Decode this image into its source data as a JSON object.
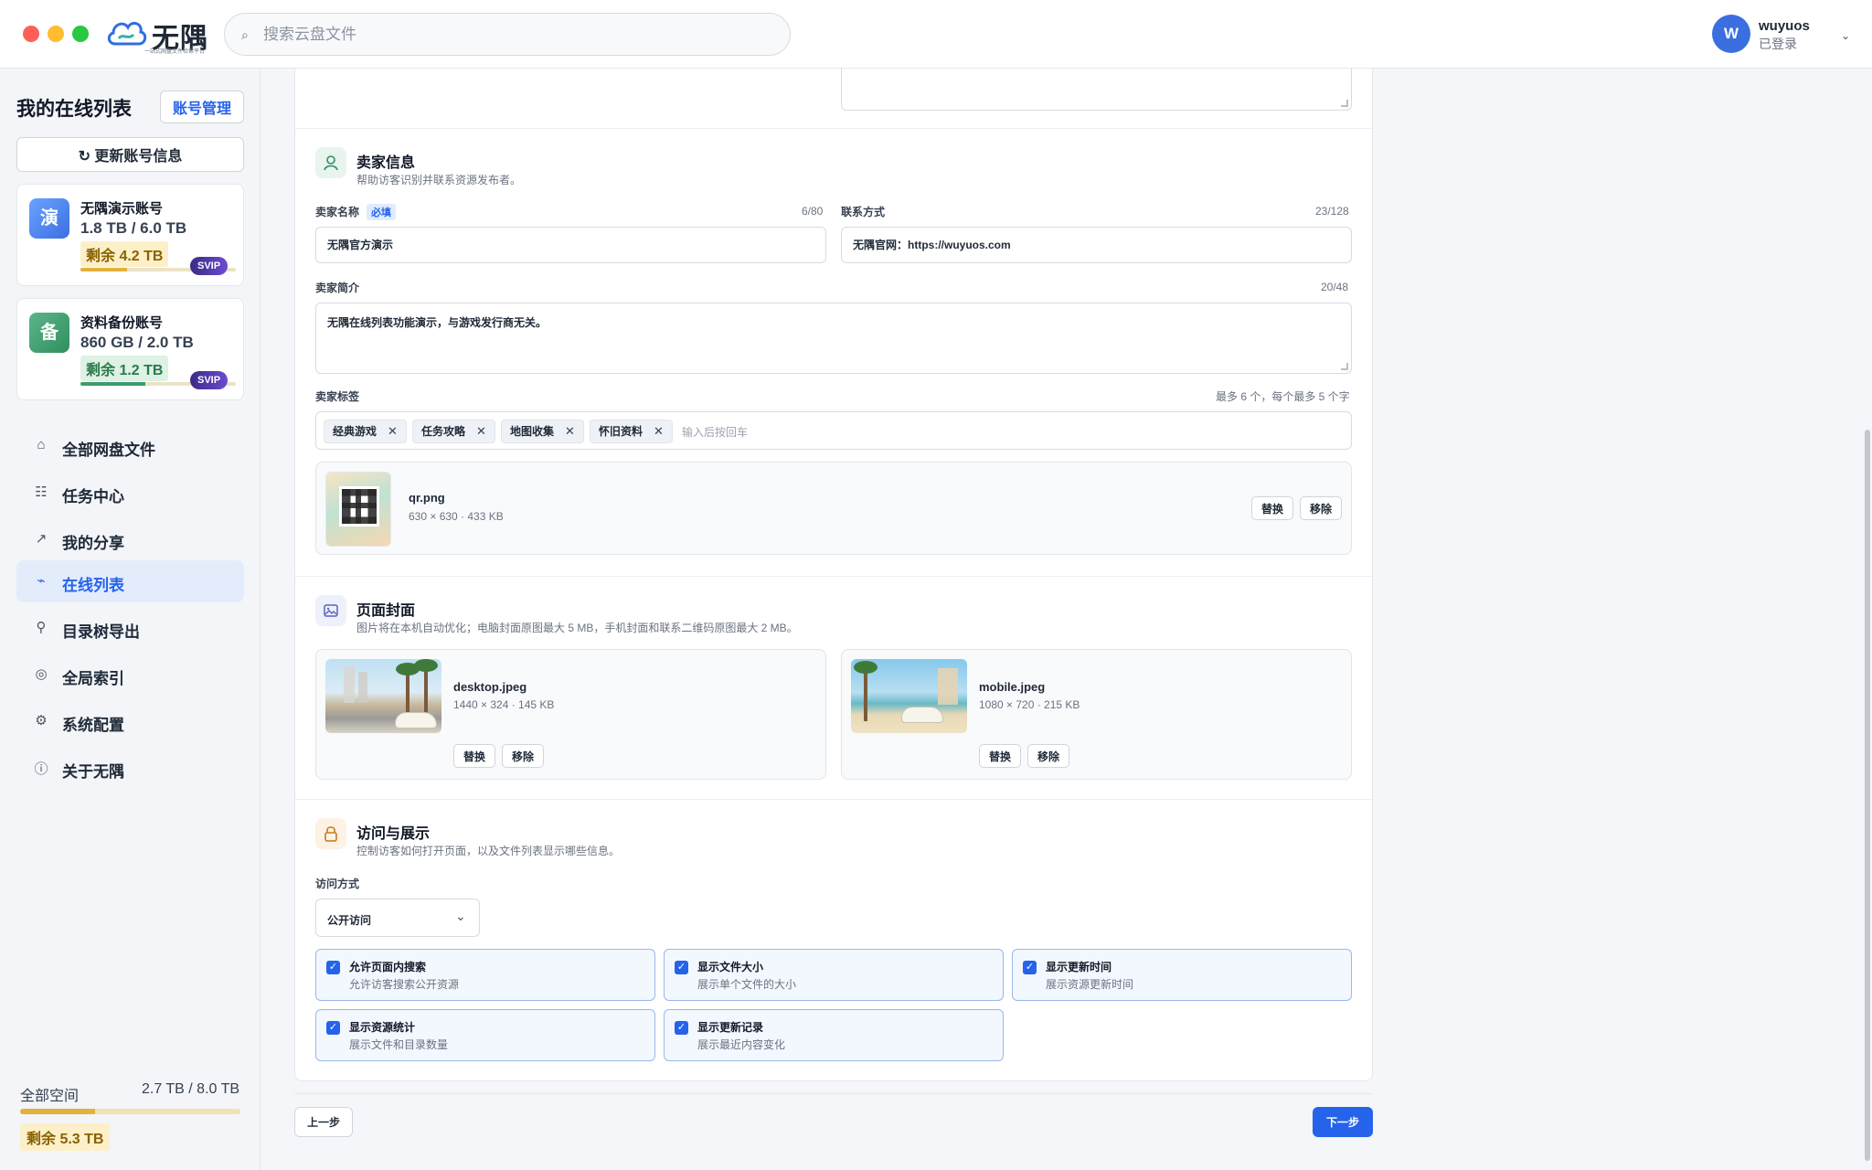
{
  "app": {
    "name": "无隅",
    "tagline": "一站式网盘文件检索平台"
  },
  "search": {
    "placeholder": "搜索云盘文件"
  },
  "user": {
    "initial": "W",
    "name": "wuyuos",
    "status": "已登录"
  },
  "sidebar": {
    "title": "我的在线列表",
    "account_manage_label": "账号管理",
    "refresh_label": "更新账号信息",
    "accounts": [
      {
        "icon_char": "演",
        "name": "无隅演示账号",
        "usage": "1.8 TB / 6.0 TB",
        "remaining": "剩余 4.2 TB",
        "badge": "SVIP",
        "used_fraction": 0.3
      },
      {
        "icon_char": "备",
        "name": "资料备份账号",
        "usage": "860 GB / 2.0 TB",
        "remaining": "剩余 1.2 TB",
        "badge": "SVIP",
        "used_fraction": 0.42
      }
    ],
    "nav": [
      {
        "label": "全部网盘文件",
        "icon": "home-icon",
        "active": false
      },
      {
        "label": "任务中心",
        "icon": "list-icon",
        "active": false
      },
      {
        "label": "我的分享",
        "icon": "share-arrow-icon",
        "active": false
      },
      {
        "label": "在线列表",
        "icon": "online-list-icon",
        "active": true
      },
      {
        "label": "目录树导出",
        "icon": "tree-icon",
        "active": false
      },
      {
        "label": "全局索引",
        "icon": "index-icon",
        "active": false
      },
      {
        "label": "系统配置",
        "icon": "gear-icon",
        "active": false
      },
      {
        "label": "关于无隅",
        "icon": "info-icon",
        "active": false
      }
    ],
    "space": {
      "label": "全部空间",
      "value": "2.7 TB / 8.0 TB",
      "remaining": "剩余 5.3 TB",
      "used_fraction": 0.34
    }
  },
  "seller": {
    "title": "卖家信息",
    "subtitle": "帮助访客识别并联系资源发布者。",
    "name_label": "卖家名称",
    "required_label": "必填",
    "name_counter": "6/80",
    "name_value": "无隅官方演示",
    "contact_label": "联系方式",
    "contact_counter": "23/128",
    "contact_value": "无隅官网：https://wuyuos.com",
    "intro_label": "卖家简介",
    "intro_counter": "20/48",
    "intro_value": "无隅在线列表功能演示，与游戏发行商无关。",
    "tags_label": "卖家标签",
    "tags_hint": "最多 6 个，每个最多 5 个字",
    "tags": [
      "经典游戏",
      "任务攻略",
      "地图收集",
      "怀旧资料"
    ],
    "tags_placeholder": "输入后按回车",
    "qr": {
      "name": "qr.png",
      "meta": "630 × 630 · 433 KB",
      "replace": "替换",
      "remove": "移除"
    }
  },
  "cover": {
    "title": "页面封面",
    "subtitle": "图片将在本机自动优化；电脑封面原图最大 5 MB，手机封面和联系二维码原图最大 2 MB。",
    "desktop": {
      "name": "desktop.jpeg",
      "meta": "1440 × 324 · 145 KB",
      "replace": "替换",
      "remove": "移除"
    },
    "mobile": {
      "name": "mobile.jpeg",
      "meta": "1080 × 720 · 215 KB",
      "replace": "替换",
      "remove": "移除"
    }
  },
  "access": {
    "title": "访问与展示",
    "subtitle": "控制访客如何打开页面，以及文件列表显示哪些信息。",
    "mode_label": "访问方式",
    "mode_value": "公开访问",
    "options": [
      {
        "title": "允许页面内搜索",
        "desc": "允许访客搜索公开资源",
        "checked": true
      },
      {
        "title": "显示文件大小",
        "desc": "展示单个文件的大小",
        "checked": true
      },
      {
        "title": "显示更新时间",
        "desc": "展示资源更新时间",
        "checked": true
      },
      {
        "title": "显示资源统计",
        "desc": "展示文件和目录数量",
        "checked": true
      },
      {
        "title": "显示更新记录",
        "desc": "展示最近内容变化",
        "checked": true
      }
    ]
  },
  "footer": {
    "prev": "上一步",
    "next": "下一步"
  },
  "colors": {
    "accent": "#2563eb",
    "active_nav_bg": "#e3ecfb"
  }
}
